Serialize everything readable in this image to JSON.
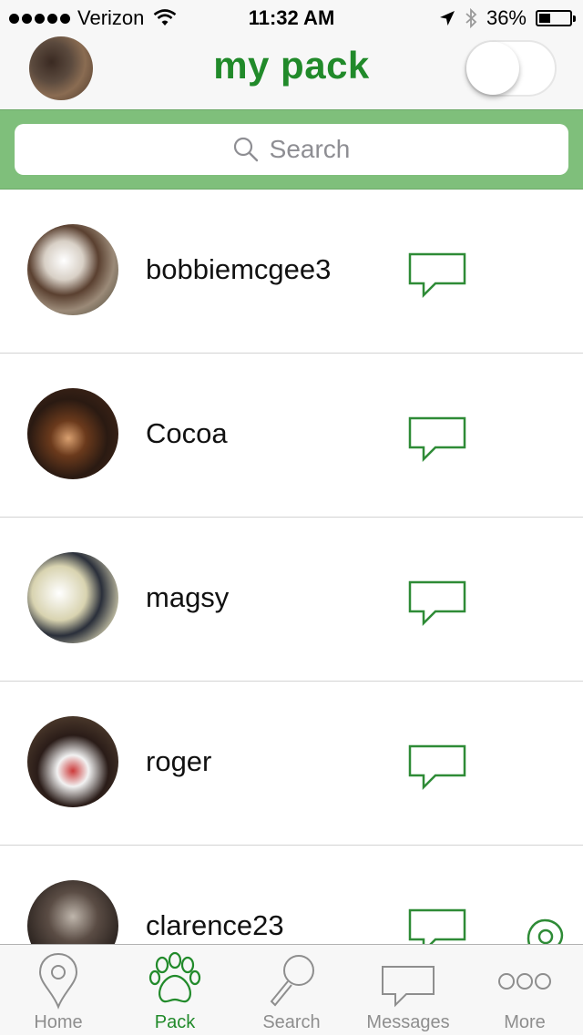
{
  "status_bar": {
    "carrier": "Verizon",
    "time": "11:32 AM",
    "battery": "36%",
    "battery_level": 0.36,
    "icons": [
      "signal-dots-icon",
      "wifi-icon",
      "location-arrow-icon",
      "bluetooth-icon",
      "battery-icon"
    ]
  },
  "nav": {
    "title": "my pack",
    "toggle_on": false
  },
  "search": {
    "placeholder": "Search"
  },
  "pack": [
    {
      "name": "bobbiemcgee3"
    },
    {
      "name": "Cocoa"
    },
    {
      "name": "magsy"
    },
    {
      "name": "roger"
    },
    {
      "name": "clarence23"
    }
  ],
  "tabs": [
    {
      "label": "Home",
      "icon": "map-pin-icon"
    },
    {
      "label": "Pack",
      "icon": "paw-icon",
      "active": true
    },
    {
      "label": "Search",
      "icon": "magnifier-icon"
    },
    {
      "label": "Messages",
      "icon": "message-bubble-icon"
    },
    {
      "label": "More",
      "icon": "more-icon"
    }
  ],
  "colors": {
    "brand_green": "#218a2a",
    "search_band": "#7fbf7b",
    "inactive": "#8e8e8e"
  }
}
